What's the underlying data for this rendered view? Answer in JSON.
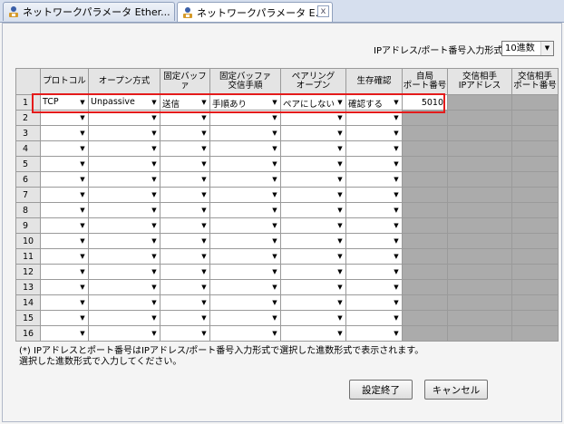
{
  "tabs": [
    {
      "label": "ネットワークパラメータ Ether..."
    },
    {
      "label": "ネットワークパラメータ E...",
      "active": true
    }
  ],
  "close_glyph": "x",
  "format": {
    "label": "IPアドレス/ポート番号入力形式",
    "value": "10進数"
  },
  "table": {
    "headers": [
      {
        "key": "protocol",
        "label": "プロトコル"
      },
      {
        "key": "open_method",
        "label": "オープン方式"
      },
      {
        "key": "fixed_buffer",
        "label": "固定バッファ"
      },
      {
        "key": "fixed_buffer_comm",
        "label": "固定バッファ\n交信手順"
      },
      {
        "key": "pairing_open",
        "label": "ペアリング\nオープン"
      },
      {
        "key": "existence_check",
        "label": "生存確認"
      },
      {
        "key": "local_port",
        "label": "自局\nポート番号"
      },
      {
        "key": "dest_ip",
        "label": "交信相手\nIPアドレス"
      },
      {
        "key": "dest_port",
        "label": "交信相手\nポート番号"
      }
    ],
    "rows": [
      {
        "no": "1",
        "protocol": "TCP",
        "open_method": "Unpassive",
        "fixed_buffer": "送信",
        "fixed_buffer_comm": "手順あり",
        "pairing_open": "ペアにしない",
        "existence_check": "確認する",
        "local_port": "5010"
      },
      {
        "no": "2"
      },
      {
        "no": "3"
      },
      {
        "no": "4"
      },
      {
        "no": "5"
      },
      {
        "no": "6"
      },
      {
        "no": "7"
      },
      {
        "no": "8"
      },
      {
        "no": "9"
      },
      {
        "no": "10"
      },
      {
        "no": "11"
      },
      {
        "no": "12"
      },
      {
        "no": "13"
      },
      {
        "no": "14"
      },
      {
        "no": "15"
      },
      {
        "no": "16"
      }
    ]
  },
  "note": {
    "line1": "(*) IPアドレスとポート番号はIPアドレス/ポート番号入力形式で選択した進数形式で表示されます。",
    "line2": "選択した進数形式で入力してください。"
  },
  "buttons": {
    "finish": "設定終了",
    "cancel": "キャンセル"
  },
  "colors": {
    "highlight": "#e41b1b",
    "disabled_cell": "#ababab",
    "header_bg": "#e4e4e4"
  },
  "icons": {
    "tab": "network-parameter-icon",
    "dropdown": "dropdown-arrow-icon",
    "close": "close-icon"
  }
}
